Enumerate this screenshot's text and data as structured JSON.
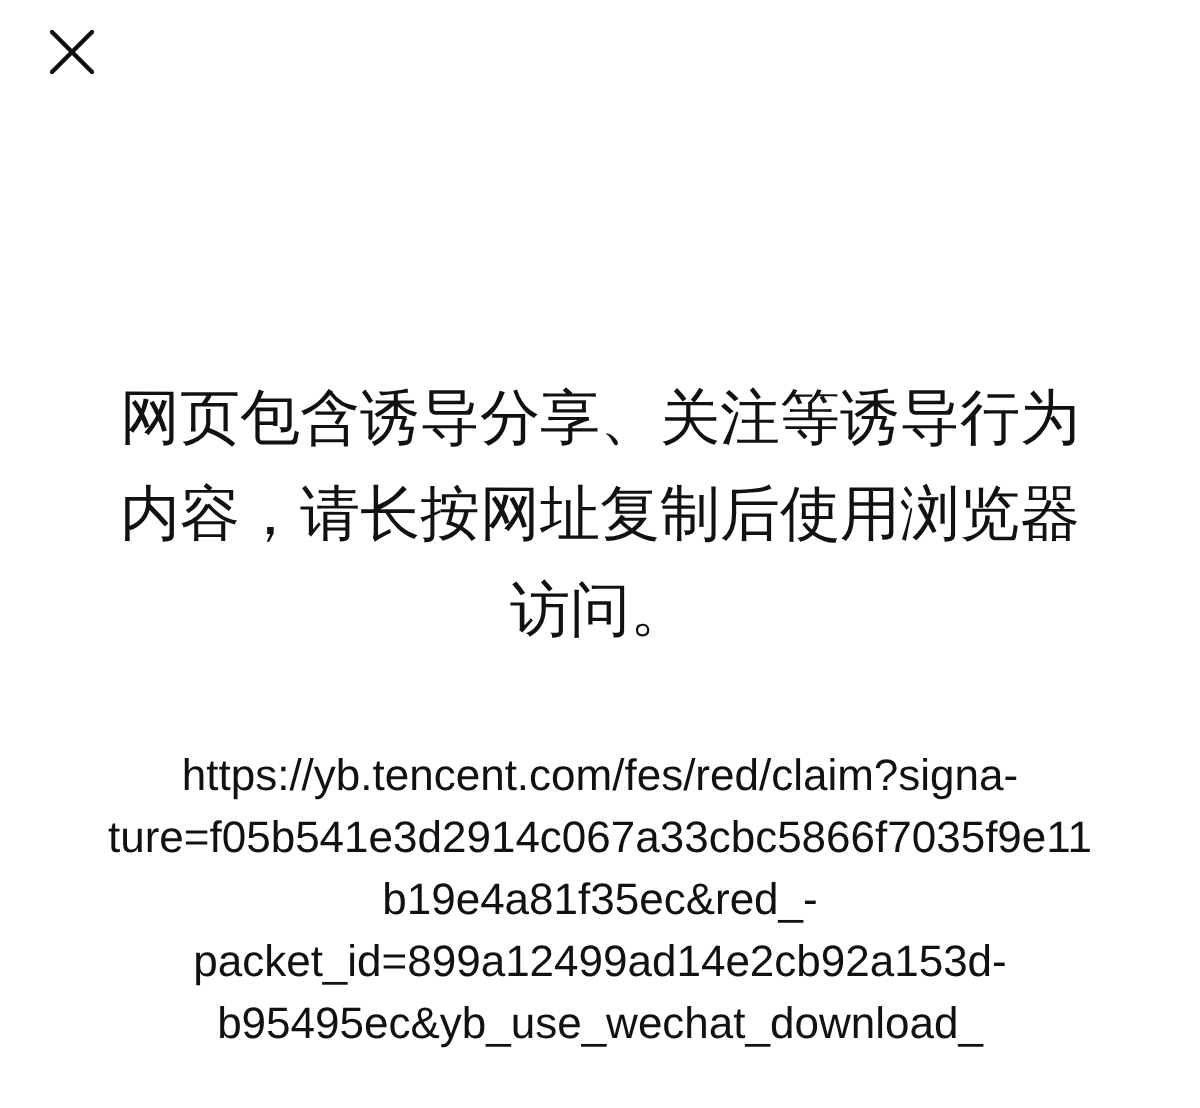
{
  "message": "网页包含诱导分享、关注等诱导行为内容，请长按网址复制后使用浏览器访问。",
  "url_lines": [
    "https://yb.tencent.com/fes/red/claim?signa-",
    "ture=f05b541e3d2914c067a33cbc5866f7035f9e11",
    "b19e4a81f35ec&red_-",
    "packet_id=899a12499ad14e2cb92a153d-",
    "b95495ec&yb_use_wechat_download_"
  ]
}
